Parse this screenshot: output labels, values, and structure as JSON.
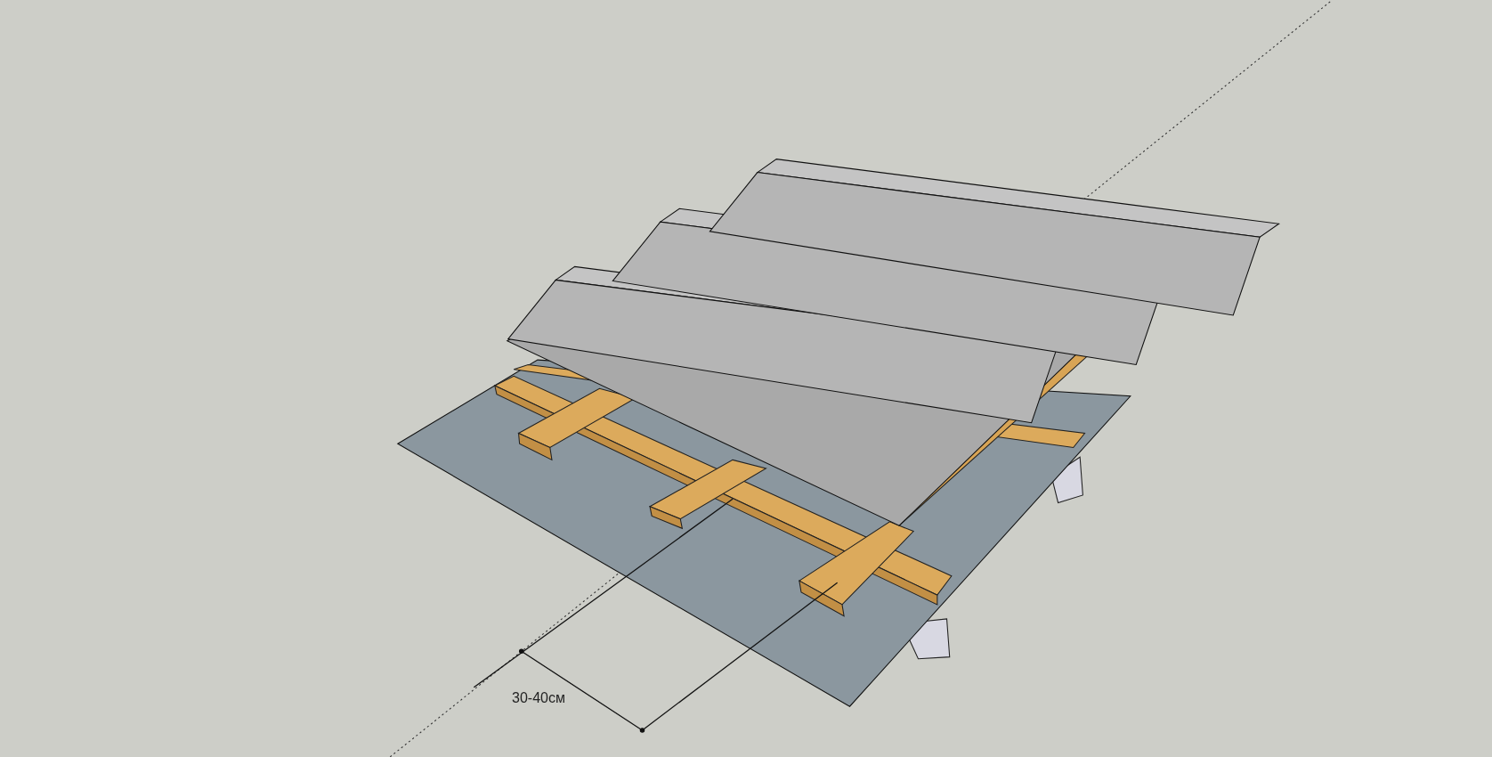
{
  "viewport": {
    "dimension_label": "30-40см"
  }
}
